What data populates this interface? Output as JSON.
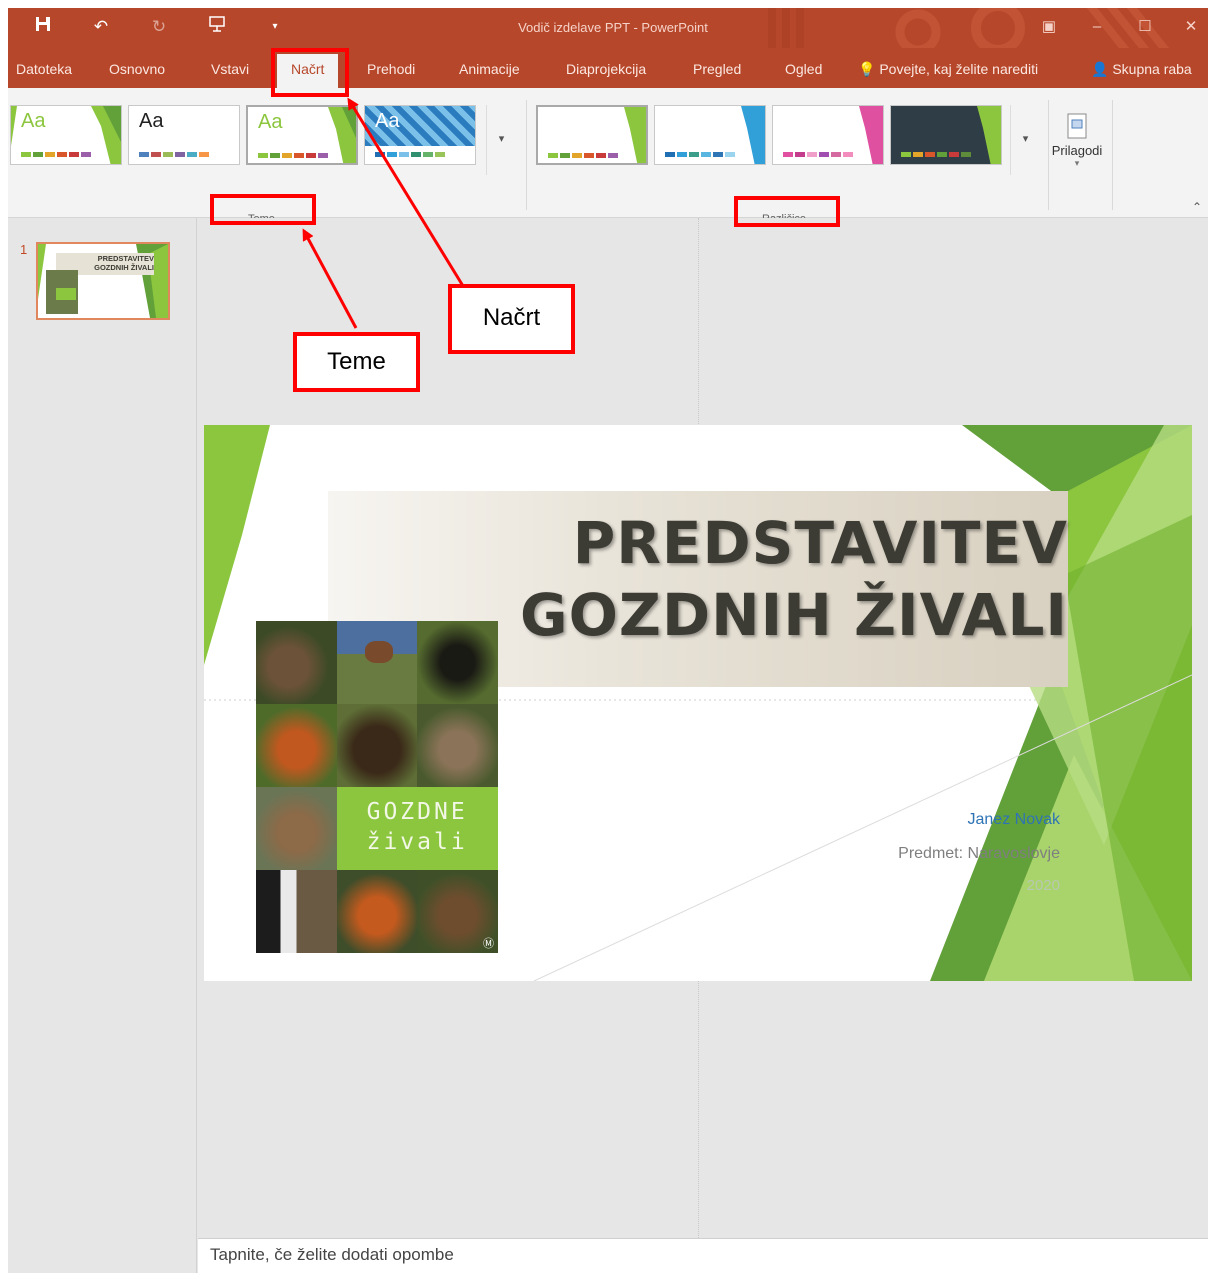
{
  "window": {
    "title": "Vodič izdelave PPT - PowerPoint",
    "quick_access": [
      "save-icon",
      "undo-icon",
      "redo-icon",
      "presenter-icon",
      "customize-icon"
    ]
  },
  "tabs": [
    {
      "label": "Datoteka"
    },
    {
      "label": "Osnovno"
    },
    {
      "label": "Vstavi"
    },
    {
      "label": "Načrt",
      "active": true
    },
    {
      "label": "Prehodi"
    },
    {
      "label": "Animacije"
    },
    {
      "label": "Diaprojekcija"
    },
    {
      "label": "Pregled"
    },
    {
      "label": "Ogled"
    }
  ],
  "tell_me": "Povejte, kaj želite narediti",
  "share": "Skupna raba",
  "ribbon": {
    "themes_group_label": "Teme",
    "variants_group_label": "Različice",
    "customize_label": "Prilagodi",
    "themes": [
      {
        "sample": "Aa",
        "accent": "#8cc63e",
        "bars": [
          "#8cc63e",
          "#62a03a",
          "#e3a42a",
          "#d9562b",
          "#c93b3b",
          "#9b5ea8",
          "#5e8c3a"
        ]
      },
      {
        "sample": "Aa",
        "accent": "#ffffff",
        "bars": [
          "#4f81bd",
          "#c0504d",
          "#9bbb59",
          "#8064a2",
          "#4bacc6",
          "#f79646",
          "#2c4d75"
        ]
      },
      {
        "sample": "Aa",
        "accent": "#8cc63e",
        "bars": [
          "#8cc63e",
          "#62a03a",
          "#e3a42a",
          "#d9562b",
          "#c93b3b",
          "#9b5ea8",
          "#5e8c3a"
        ]
      },
      {
        "sample": "Aa",
        "accent": "#2a7cbf",
        "bars": [
          "#1f6fb2",
          "#31a0d8",
          "#7ac0e8",
          "#2f8f6e",
          "#65b36a",
          "#98c45a",
          "#1f4e79"
        ]
      }
    ],
    "variants": [
      {
        "accent": "#8cc63e",
        "bars": [
          "#8cc63e",
          "#62a03a",
          "#e3a42a",
          "#d9562b",
          "#c93b3b",
          "#9b5ea8"
        ]
      },
      {
        "accent": "#31a0d8",
        "bars": [
          "#1f6fb2",
          "#31a0d8",
          "#3c9e8a",
          "#59b6e0",
          "#2e75b6",
          "#9bd4ef"
        ]
      },
      {
        "accent": "#e050a0",
        "bars": [
          "#e050a0",
          "#c43d8c",
          "#f0a0c8",
          "#a04fb0",
          "#d46aa0",
          "#f28dbd"
        ]
      },
      {
        "accent": "#8cc63e",
        "bars": [
          "#8cc63e",
          "#e3a42a",
          "#d9562b",
          "#62a03a",
          "#c93b3b",
          "#5e8c3a"
        ]
      }
    ]
  },
  "slides_panel": {
    "slide_number": "1"
  },
  "slide": {
    "title_line1": "PREDSTAVITEV",
    "title_line2": "GOZDNIH ŽIVALI",
    "author": "Janez Novak",
    "subject": "Predmet: Naravoslovje",
    "year": "2020",
    "cover_line1": "GOZDNE",
    "cover_line2": "živali",
    "thumb_title_line1": "PREDSTAVITEV",
    "thumb_title_line2": "GOZDNIH ŽIVALI"
  },
  "notes_placeholder": "Tapnite, če želite dodati opombe",
  "annotations": {
    "callout_nacrt": "Načrt",
    "callout_teme": "Teme"
  },
  "colors": {
    "accent": "#b7472a",
    "annotation": "#ff0000",
    "slide_green": "#8cc63e"
  }
}
